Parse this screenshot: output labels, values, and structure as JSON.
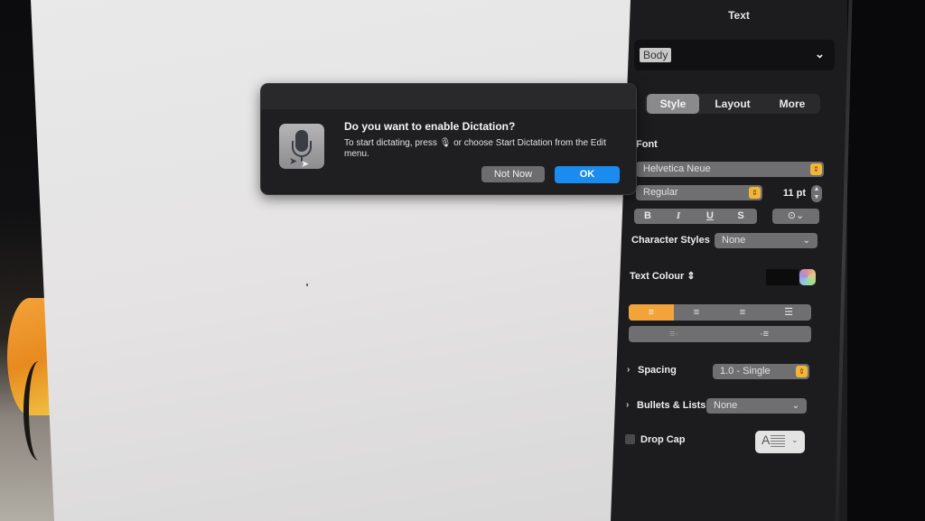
{
  "dialog": {
    "title": "Do you want to enable Dictation?",
    "body": "To start dictating, press 🎙 or choose Start Dictation from the Edit menu.",
    "not_now_label": "Not Now",
    "ok_label": "OK",
    "icon": "microphone-icon"
  },
  "inspector": {
    "title": "Text",
    "paragraph_style": "Body",
    "tabs": [
      {
        "label": "Style",
        "selected": true
      },
      {
        "label": "Layout",
        "selected": false
      },
      {
        "label": "More",
        "selected": false
      }
    ],
    "font": {
      "section_label": "Font",
      "family": "Helvetica Neue",
      "typeface": "Regular",
      "size": "11 pt",
      "bold": "B",
      "italic": "I",
      "underline": "U",
      "strikethrough": "S"
    },
    "character_styles": {
      "label": "Character Styles",
      "value": "None"
    },
    "text_colour": {
      "label": "Text Colour ⇕",
      "value": "#000000"
    },
    "alignment": {
      "selected": "left",
      "options": [
        "left",
        "center",
        "right",
        "justify"
      ]
    },
    "spacing": {
      "label": "Spacing",
      "value": "1.0 - Single"
    },
    "bullets_lists": {
      "label": "Bullets & Lists",
      "value": "None"
    },
    "drop_cap": {
      "label": "Drop Cap",
      "checked": false
    },
    "accent_color": "#f2a33a"
  },
  "icons": {
    "stepper": "⇕",
    "chevron": "⌄",
    "disclosure": "›",
    "more_options": "⊙⌄"
  }
}
